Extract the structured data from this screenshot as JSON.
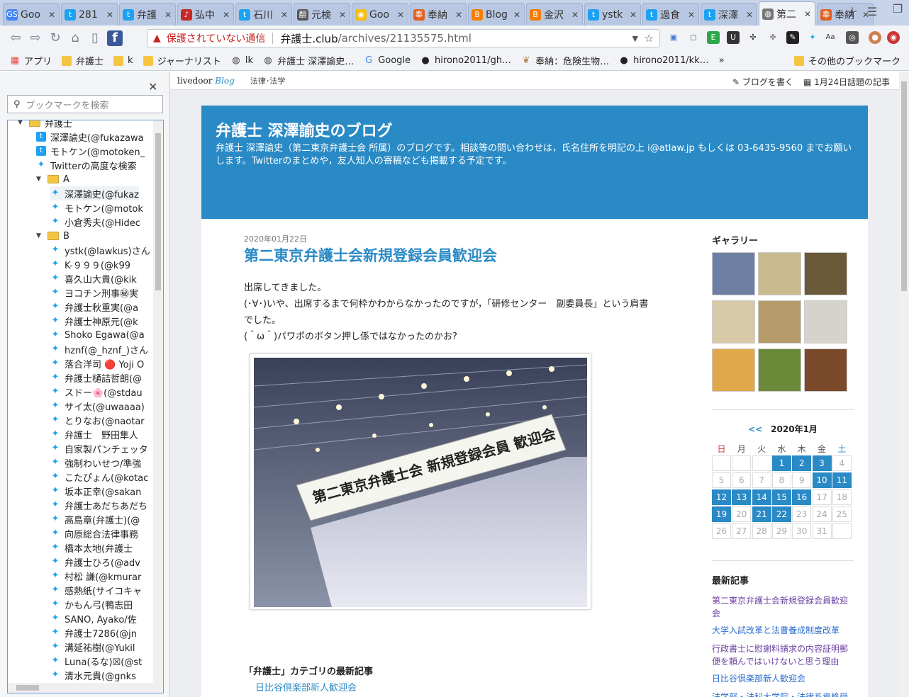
{
  "tabs": [
    {
      "label": "Goo",
      "fav": "GS",
      "color": "#4285f4"
    },
    {
      "label": "281",
      "fav": "t",
      "color": "#1da1f2"
    },
    {
      "label": "弁護",
      "fav": "t",
      "color": "#1da1f2"
    },
    {
      "label": "弘中",
      "fav": "♪",
      "color": "#c62828"
    },
    {
      "label": "石川",
      "fav": "t",
      "color": "#1da1f2"
    },
    {
      "label": "元検",
      "fav": "翻",
      "color": "#555"
    },
    {
      "label": "Goo",
      "fav": "◉",
      "color": "#fbbc05"
    },
    {
      "label": "奉納",
      "fav": "奉",
      "color": "#e06020"
    },
    {
      "label": "Blog",
      "fav": "B",
      "color": "#f57d00"
    },
    {
      "label": "金沢",
      "fav": "B",
      "color": "#f57d00"
    },
    {
      "label": "ystk",
      "fav": "t",
      "color": "#1da1f2"
    },
    {
      "label": "過食",
      "fav": "t",
      "color": "#1da1f2"
    },
    {
      "label": "深澤",
      "fav": "t",
      "color": "#1da1f2"
    },
    {
      "label": "第二",
      "fav": "◍",
      "color": "#777"
    },
    {
      "label": "奉納",
      "fav": "奉",
      "color": "#e06020"
    }
  ],
  "omnibox": {
    "security": "保護されていない通信",
    "host": "弁護士.club",
    "path": "/archives/21135575.html"
  },
  "bookmarks": [
    {
      "label": "アプリ",
      "icon": "apps"
    },
    {
      "label": "弁護士",
      "icon": "folder"
    },
    {
      "label": "k",
      "icon": "folder"
    },
    {
      "label": "ジャーナリスト",
      "icon": "folder"
    },
    {
      "label": "lk",
      "icon": "globe"
    },
    {
      "label": "弁護士 深澤諭史…",
      "icon": "globe"
    },
    {
      "label": "Google",
      "icon": "google"
    },
    {
      "label": "hirono2011/gh…",
      "icon": "github"
    },
    {
      "label": "奉納：危険生物…",
      "icon": "bird"
    },
    {
      "label": "hirono2011/kk…",
      "icon": "github"
    },
    {
      "label": "»",
      "icon": "none"
    },
    {
      "label": "その他のブックマーク",
      "icon": "folder"
    }
  ],
  "sidebar": {
    "search_placeholder": "ブックマークを検索",
    "items": [
      {
        "label": "弁護士",
        "type": "folder",
        "indent": 0
      },
      {
        "label": "深澤諭史(@fukazawa",
        "type": "tbox",
        "indent": 2
      },
      {
        "label": "モトケン(@motoken_",
        "type": "tbox",
        "indent": 2
      },
      {
        "label": "Twitterの高度な検索",
        "type": "tw",
        "indent": 2
      },
      {
        "label": "A",
        "type": "folder",
        "indent": 1
      },
      {
        "label": "深澤諭史(@fukaz",
        "type": "tw",
        "indent": 3
      },
      {
        "label": "モトケン(@motok",
        "type": "tw",
        "indent": 3
      },
      {
        "label": "小倉秀夫(@Hidec",
        "type": "tw",
        "indent": 3
      },
      {
        "label": "B",
        "type": "folder",
        "indent": 1
      },
      {
        "label": "ystk(@lawkus)さん",
        "type": "tw",
        "indent": 3
      },
      {
        "label": "K-９９９(@k99",
        "type": "tw",
        "indent": 3
      },
      {
        "label": "喜久山大貴(@kik",
        "type": "tw",
        "indent": 3
      },
      {
        "label": "ヨコチン刑事㊙実",
        "type": "tw",
        "indent": 3
      },
      {
        "label": "弁護士秋重実(@a",
        "type": "tw",
        "indent": 3
      },
      {
        "label": "弁護士神原元(@k",
        "type": "tw",
        "indent": 3
      },
      {
        "label": "Shoko Egawa(@a",
        "type": "tw",
        "indent": 3
      },
      {
        "label": "hznf(@_hznf_)さん",
        "type": "tw",
        "indent": 3
      },
      {
        "label": "落合洋司 🔴 Yoji O",
        "type": "tw",
        "indent": 3
      },
      {
        "label": "弁護士樋詰哲朗(@",
        "type": "tw",
        "indent": 3
      },
      {
        "label": "スドー🌸(@stdau",
        "type": "tw",
        "indent": 3
      },
      {
        "label": "サイ太(@uwaaaa)",
        "type": "tw",
        "indent": 3
      },
      {
        "label": "とりなお(@naotar",
        "type": "tw",
        "indent": 3
      },
      {
        "label": "弁護士　野田隼人",
        "type": "tw",
        "indent": 3
      },
      {
        "label": "自家製パンチェッタ",
        "type": "tw",
        "indent": 3
      },
      {
        "label": "強制わいせつ/準強",
        "type": "tw",
        "indent": 3
      },
      {
        "label": "こたぴょん(@kotac",
        "type": "tw",
        "indent": 3
      },
      {
        "label": "坂本正幸(@sakan",
        "type": "tw",
        "indent": 3
      },
      {
        "label": "弁護士あだちあだち",
        "type": "tw",
        "indent": 3
      },
      {
        "label": "高島章(弁護士)(@",
        "type": "tw",
        "indent": 3
      },
      {
        "label": "向原総合法律事務",
        "type": "tw",
        "indent": 3
      },
      {
        "label": "橋本太地(弁護士",
        "type": "tw",
        "indent": 3
      },
      {
        "label": "弁護士ひろ(@adv",
        "type": "tw",
        "indent": 3
      },
      {
        "label": "村松 謙(@kmurar",
        "type": "tw",
        "indent": 3
      },
      {
        "label": "感熱紙(サイコキャ",
        "type": "tw",
        "indent": 3
      },
      {
        "label": "かもん弓(鴨志田",
        "type": "tw",
        "indent": 3
      },
      {
        "label": "SANO, Ayako/佐",
        "type": "tw",
        "indent": 3
      },
      {
        "label": "弁護士7286(@jn",
        "type": "tw",
        "indent": 3
      },
      {
        "label": "溝延祐樹(@Yukil",
        "type": "tw",
        "indent": 3
      },
      {
        "label": "Luna(るな)☒(@st",
        "type": "tw",
        "indent": 3
      },
      {
        "label": "清水元貴(@gnks",
        "type": "tw",
        "indent": 3
      }
    ]
  },
  "livedoor": {
    "logo_a": "livedoor",
    "logo_b": "Blog",
    "category": "法律･法学",
    "write": "ブログを書く",
    "topic": "1月24日話題の記事"
  },
  "blog": {
    "title": "弁護士 深澤諭史のブログ",
    "desc": "弁護士 深澤諭史（第二東京弁護士会 所属）のブログです。相談等の問い合わせは，氏名住所を明記の上 i@atlaw.jp もしくは 03-6435-9560 までお願いします。Twitterのまとめや，友人知人の寄稿なども掲載する予定です。"
  },
  "post": {
    "date": "2020年01月22日",
    "title": "第二東京弁護士会新規登録会員歓迎会",
    "lines": [
      "出席してきました。",
      "(･∀･)いや、出席するまで何枠かわからなかったのですが，「研修センター　副委員長」という肩書でした。",
      "(＾ω＾)パワポのボタン押し係ではなかったのかお?"
    ],
    "banner": "第二東京弁護士会 新規登録会員 歓迎会"
  },
  "category": {
    "heading": "「弁護士」カテゴリの最新記事",
    "link": "日比谷倶楽部新人歓迎会"
  },
  "gallery": {
    "heading": "ギャラリー",
    "colors": [
      "#6d7fa3",
      "#c9b98f",
      "#6a5a3a",
      "#d8c9a8",
      "#b59a6a",
      "#d6d2cc",
      "#e0a84a",
      "#6a8a3a",
      "#7a4a2a"
    ]
  },
  "calendar": {
    "prev": "<<",
    "month": "2020年1月",
    "dow": [
      "日",
      "月",
      "火",
      "水",
      "木",
      "金",
      "土"
    ],
    "days": [
      "",
      "",
      "",
      "1",
      "2",
      "3",
      "4",
      "5",
      "6",
      "7",
      "8",
      "9",
      "10",
      "11",
      "12",
      "13",
      "14",
      "15",
      "16",
      "17",
      "18",
      "19",
      "20",
      "21",
      "22",
      "23",
      "24",
      "25",
      "26",
      "27",
      "28",
      "29",
      "30",
      "31",
      ""
    ],
    "active": [
      "1",
      "2",
      "3",
      "10",
      "11",
      "12",
      "13",
      "14",
      "15",
      "16",
      "19",
      "21",
      "22"
    ]
  },
  "recent": {
    "heading": "最新記事",
    "items": [
      "第二東京弁護士会新規登録会員歓迎会",
      "大学入試改革と法曹養成制度改革",
      "行政書士に慰謝料請求の内容証明郵便を頼んではいけないと思う理由",
      "日比谷倶楽部新人歓迎会",
      "法学部・法科大学院・法律系資格受験"
    ]
  }
}
